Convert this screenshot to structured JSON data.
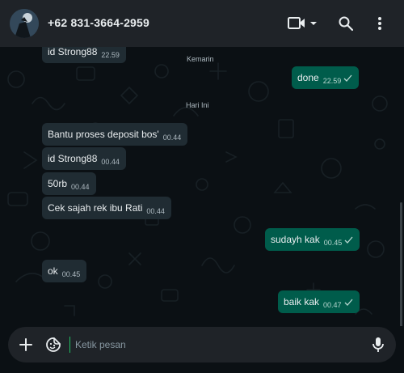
{
  "header": {
    "contact_name": "+62 831-3664-2959",
    "icons": [
      "avatar",
      "video-call-icon",
      "dropdown-caret-icon",
      "search-icon",
      "more-vert-icon"
    ]
  },
  "chat": {
    "date_separators": [
      "Kemarin",
      "Hari Ini"
    ],
    "messages": [
      {
        "direction": "in",
        "text": "id Strong88",
        "time": "22.59"
      },
      {
        "direction": "out",
        "text": "done",
        "time": "22.59",
        "status": "sent"
      },
      {
        "direction": "in",
        "text": "Bantu proses deposit bos'",
        "time": "00.44"
      },
      {
        "direction": "in",
        "text": "id Strong88",
        "time": "00.44"
      },
      {
        "direction": "in",
        "text": "50rb",
        "time": "00.44"
      },
      {
        "direction": "in",
        "text": "Cek sajah rek ibu Rati",
        "time": "00.44"
      },
      {
        "direction": "out",
        "text": "sudayh kak",
        "time": "00.45",
        "status": "sent"
      },
      {
        "direction": "in",
        "text": "ok",
        "time": "00.45"
      },
      {
        "direction": "out",
        "text": "baik kak",
        "time": "00.47",
        "status": "sent"
      }
    ]
  },
  "composer": {
    "placeholder": "Ketik pesan",
    "icons": [
      "plus-icon",
      "sticker-icon",
      "microphone-icon"
    ]
  },
  "colors": {
    "header_bg": "#1f2328",
    "chat_bg": "#0b1014",
    "incoming_bubble": "#202c33",
    "outgoing_bubble": "#005c4b",
    "accent": "#21c063"
  }
}
